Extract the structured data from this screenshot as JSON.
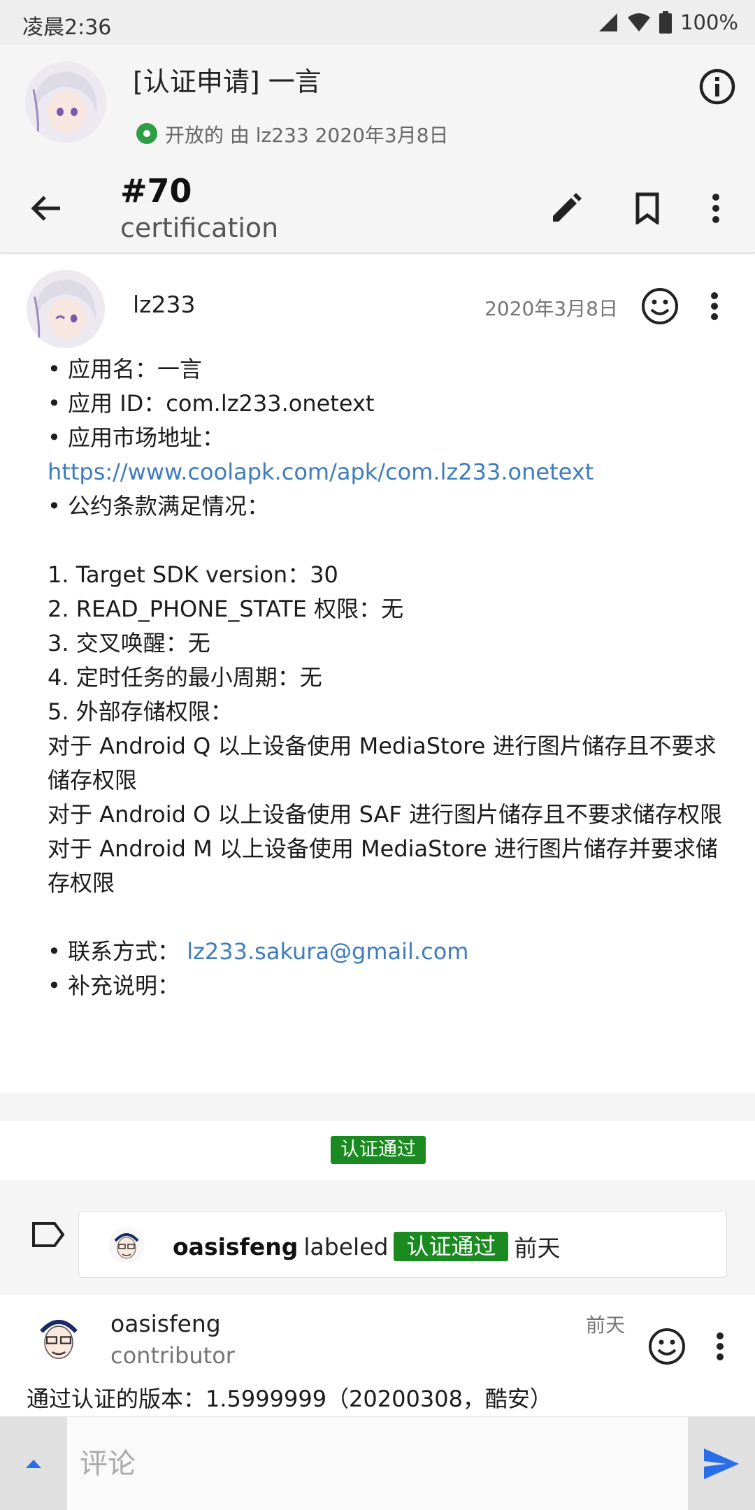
{
  "status_bar": {
    "time": "凌晨2:36",
    "battery": "100%"
  },
  "issue": {
    "title": "[认证申请] 一言",
    "state": "开放的",
    "meta": "开放的 由 lz233 2020年3月8日"
  },
  "toolbar": {
    "number": "#70",
    "repo": "certification"
  },
  "comment": {
    "author": "lz233",
    "date": "2020年3月8日",
    "lines": [
      "• 应用名：一言",
      "• 应用 ID：com.lz233.onetext",
      "• 应用市场地址：",
      "https://www.coolapk.com/apk/com.lz233.onetext",
      "• 公约条款满足情况：",
      "",
      "1. Target SDK version：30",
      "2. READ_PHONE_STATE 权限：无",
      "3. 交叉唤醒：无",
      "4. 定时任务的最小周期：无",
      "5. 外部存储权限：",
      "对于 Android Q 以上设备使用 MediaStore 进行图片储存且不要求储存权限",
      "对于 Android O 以上设备使用 SAF 进行图片储存且不要求储存权限",
      "对于 Android M 以上设备使用 MediaStore 进行图片储存并要求储存权限",
      ""
    ],
    "contact_label": "• 联系方式：",
    "contact_email": "lz233.sakura@gmail.com",
    "extra_label": "• 补充说明："
  },
  "labels": {
    "applied": "认证通过"
  },
  "event": {
    "actor": "oasisfeng",
    "action": "labeled",
    "label": "认证通过",
    "time": "前天"
  },
  "comment2": {
    "author": "oasisfeng",
    "role": "contributor",
    "date": "前天",
    "body": "通过认证的版本：1.5999999（20200308，酷安）"
  },
  "input": {
    "placeholder": "评论"
  },
  "colors": {
    "label_green": "#1b8a21",
    "link_blue": "#3f7cbd",
    "send_blue": "#2a6de8",
    "open_green": "#2e9e45"
  }
}
